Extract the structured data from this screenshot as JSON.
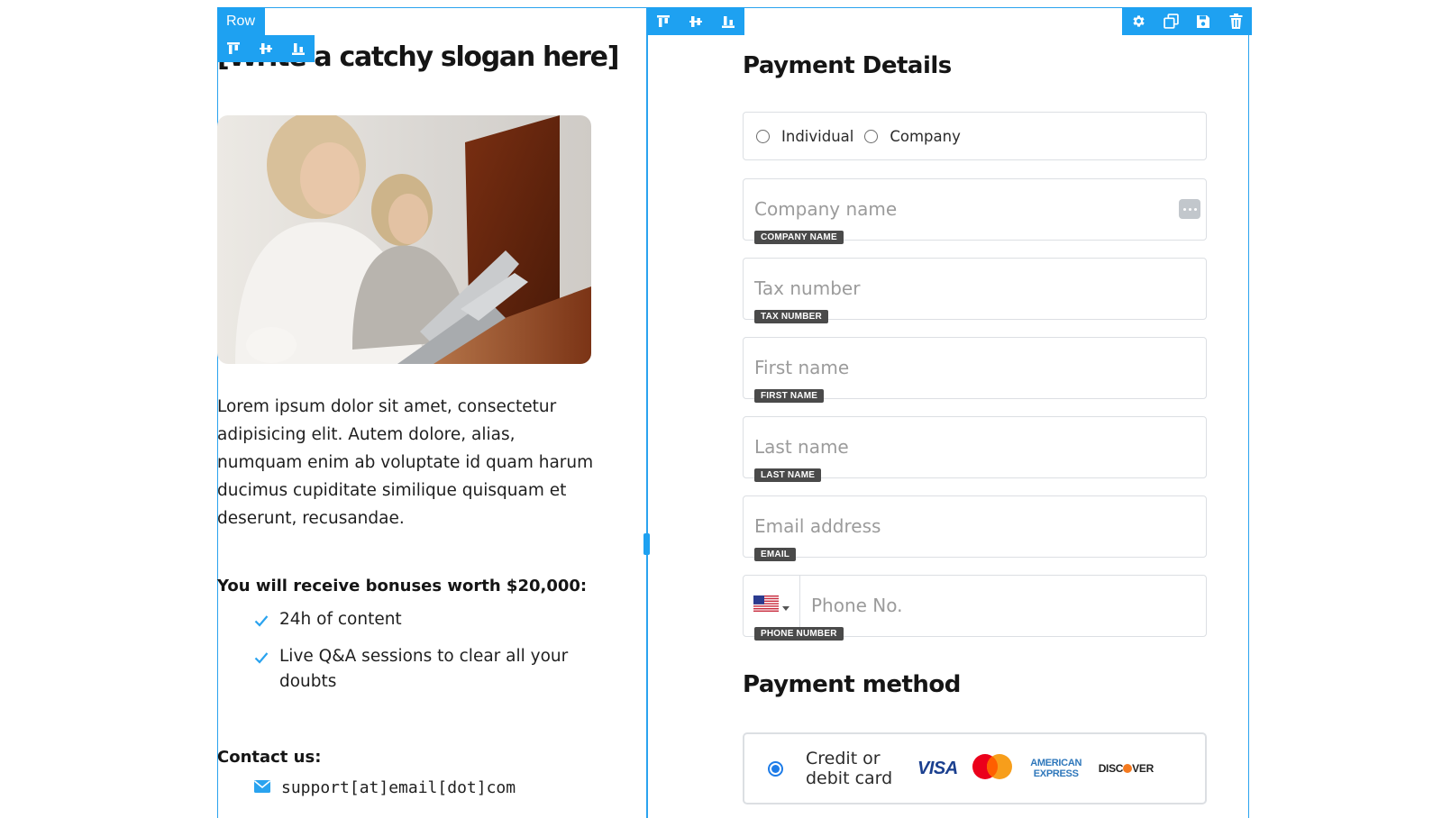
{
  "builder": {
    "row_label": "Row"
  },
  "left": {
    "slogan": "[Write a catchy slogan here]",
    "intro": "Lorem ipsum dolor sit amet, consectetur adipisicing elit. Autem dolore, alias, numquam enim ab voluptate id quam harum ducimus cupiditate similique quisquam et deserunt, recusandae.",
    "bonus_heading": "You will receive bonuses worth $20,000:",
    "bonuses": [
      "24h of content",
      "Live Q&A sessions to clear all your doubts"
    ],
    "contact_heading": "Contact us:",
    "contact_email": "support[at]email[dot]com"
  },
  "form": {
    "title": "Payment Details",
    "type_options": [
      "Individual",
      "Company"
    ],
    "fields": {
      "company": {
        "placeholder": "Company name",
        "tag": "COMPANY NAME"
      },
      "tax": {
        "placeholder": "Tax number",
        "tag": "TAX NUMBER"
      },
      "first": {
        "placeholder": "First name",
        "tag": "FIRST NAME"
      },
      "last": {
        "placeholder": "Last name",
        "tag": "LAST NAME"
      },
      "email": {
        "placeholder": "Email address",
        "tag": "EMAIL"
      },
      "phone": {
        "placeholder": "Phone No.",
        "tag": "PHONE NUMBER"
      }
    },
    "method_title": "Payment method",
    "card_option": "Credit or debit card",
    "card_brands": {
      "visa": "VISA",
      "amex": "AMERICAN EXPRESS",
      "discover_pre": "DISC",
      "discover_post": "VER"
    }
  },
  "colors": {
    "accent": "#1ea1f1",
    "radio_selected": "#1e7ce8"
  }
}
